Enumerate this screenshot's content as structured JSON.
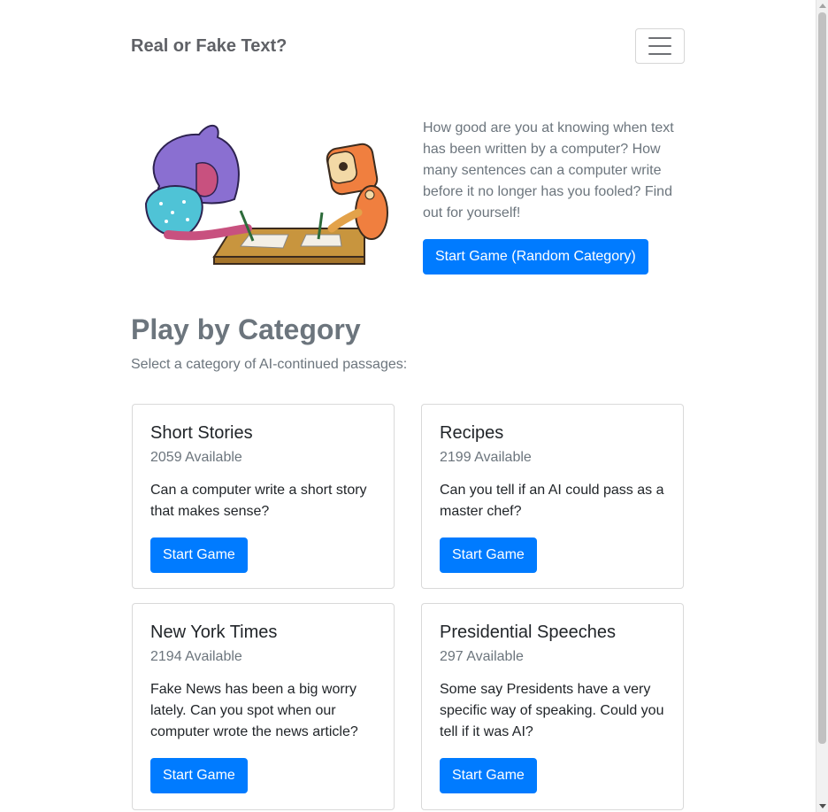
{
  "navbar": {
    "brand": "Real or Fake Text?",
    "menu_icon": "hamburger-menu-icon"
  },
  "hero": {
    "illustration": "person-and-robot-writing-illustration",
    "description": "How good are you at knowing when text has been written by a computer? How many sentences can a computer write before it no longer has you fooled? Find out for yourself!",
    "button_label": "Start Game (Random Category)"
  },
  "category_section": {
    "title": "Play by Category",
    "subtitle": "Select a category of AI-continued passages:"
  },
  "categories": [
    {
      "title": "Short Stories",
      "available": "2059 Available",
      "description": "Can a computer write a short story that makes sense?",
      "button_label": "Start Game"
    },
    {
      "title": "Recipes",
      "available": "2199 Available",
      "description": "Can you tell if an AI could pass as a master chef?",
      "button_label": "Start Game"
    },
    {
      "title": "New York Times",
      "available": "2194 Available",
      "description": "Fake News has been a big worry lately. Can you spot when our computer wrote the news article?",
      "button_label": "Start Game"
    },
    {
      "title": "Presidential Speeches",
      "available": "297 Available",
      "description": "Some say Presidents have a very specific way of speaking. Could you tell if it was AI?",
      "button_label": "Start Game"
    }
  ],
  "colors": {
    "primary": "#007bff",
    "muted": "#6c757d",
    "text": "#212529"
  }
}
